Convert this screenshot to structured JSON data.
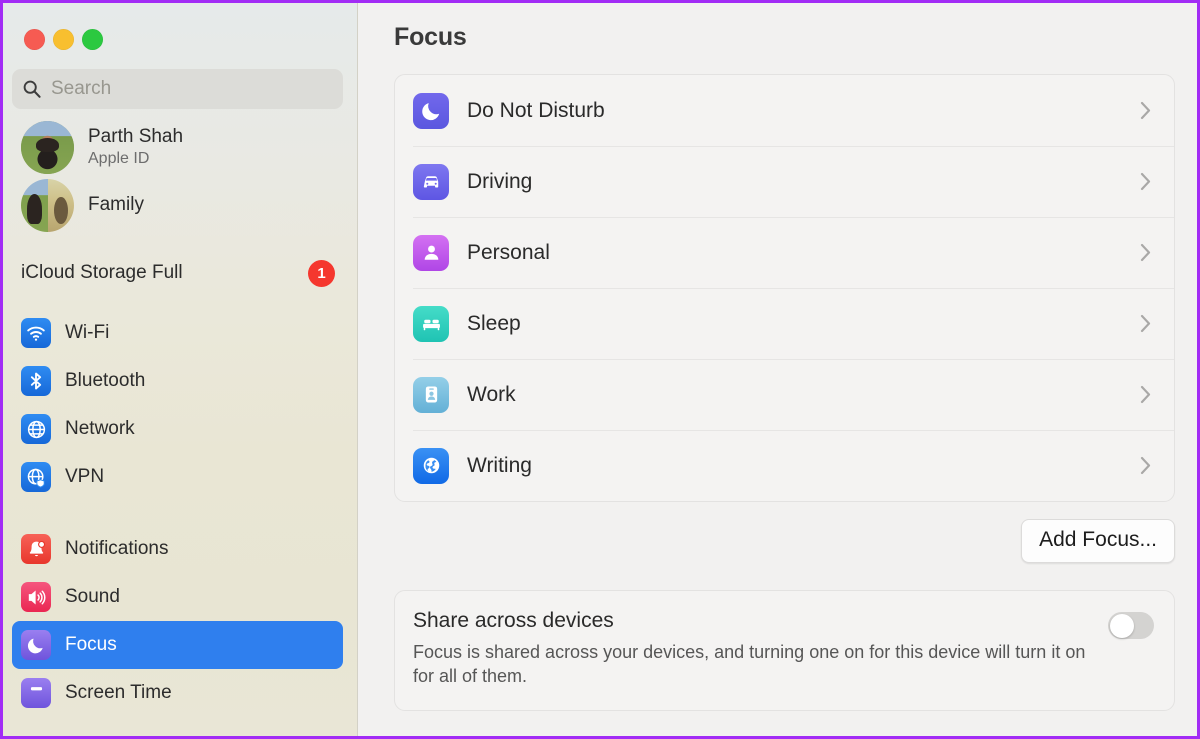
{
  "window": {
    "traffic_lights": [
      {
        "name": "close",
        "color": "#f65b52"
      },
      {
        "name": "minimize",
        "color": "#f8bf2f"
      },
      {
        "name": "zoom",
        "color": "#2bc940"
      }
    ],
    "accent_selected": "#2f7fee",
    "border_color": "#a22cf5"
  },
  "sidebar": {
    "search": {
      "placeholder": "Search",
      "value": "",
      "icon": "search-icon"
    },
    "account": {
      "name": "Parth Shah",
      "subtitle": "Apple ID",
      "avatar": "user-avatar"
    },
    "family": {
      "label": "Family",
      "avatar": "family-avatar"
    },
    "alert": {
      "label": "iCloud Storage Full",
      "badge": "1",
      "badge_color": "#f5372e"
    },
    "groups": [
      {
        "items": [
          {
            "label": "Wi-Fi",
            "icon": "wifi-icon",
            "color": "#1f7ae0",
            "selected": false
          },
          {
            "label": "Bluetooth",
            "icon": "bluetooth-icon",
            "color": "#1f7ae0",
            "selected": false
          },
          {
            "label": "Network",
            "icon": "network-icon",
            "color": "#1f7ae0",
            "selected": false
          },
          {
            "label": "VPN",
            "icon": "vpn-icon",
            "color": "#1f7ae0",
            "selected": false
          }
        ]
      },
      {
        "items": [
          {
            "label": "Notifications",
            "icon": "bell-icon",
            "color": "#f0483e",
            "selected": false
          },
          {
            "label": "Sound",
            "icon": "speaker-icon",
            "color": "#f03c62",
            "selected": false
          },
          {
            "label": "Focus",
            "icon": "moon-icon",
            "color": "#7b5ce0",
            "selected": true
          },
          {
            "label": "Screen Time",
            "icon": "hourglass-icon",
            "color": "#7b5ce0",
            "selected": false
          }
        ]
      }
    ]
  },
  "main": {
    "title": "Focus",
    "focus_items": [
      {
        "label": "Do Not Disturb",
        "icon": "moon-icon",
        "color_start": "#6e62e8",
        "color_end": "#5b5ae0"
      },
      {
        "label": "Driving",
        "icon": "car-icon",
        "color_start": "#7b74ee",
        "color_end": "#5f57e4"
      },
      {
        "label": "Personal",
        "icon": "person-icon",
        "color_start": "#cf6ef0",
        "color_end": "#b24ae6"
      },
      {
        "label": "Sleep",
        "icon": "bed-icon",
        "color_start": "#3fd9c6",
        "color_end": "#22c4b4"
      },
      {
        "label": "Work",
        "icon": "badge-id-icon",
        "color_start": "#8ecbe6",
        "color_end": "#63b2d6"
      },
      {
        "label": "Writing",
        "icon": "globe-icon",
        "color_start": "#2a86f0",
        "color_end": "#1470e8"
      }
    ],
    "chevron_icon": "chevron-right-icon",
    "add_focus_label": "Add Focus...",
    "share": {
      "title": "Share across devices",
      "description": "Focus is shared across your devices, and turning one on for this device will turn it on for all of them.",
      "toggle_state": "off",
      "toggle_name": "share-across-devices-toggle"
    }
  }
}
